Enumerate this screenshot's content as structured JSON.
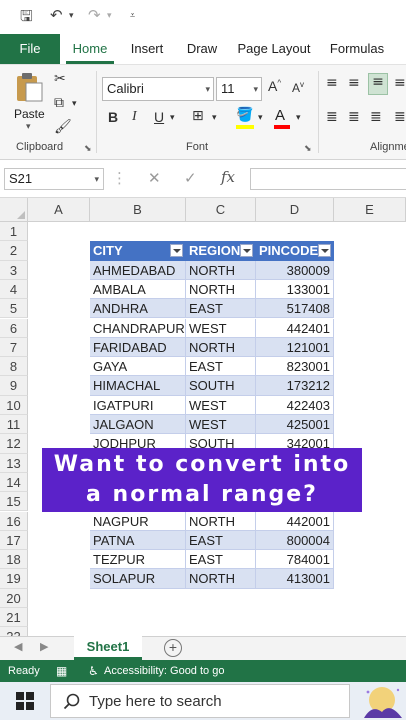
{
  "quick_access": {
    "save_icon": "save-icon",
    "undo_icon": "undo-icon",
    "redo_icon": "redo-icon",
    "customize_icon": "customize-icon"
  },
  "ribbon_tabs": [
    {
      "label": "File"
    },
    {
      "label": "Home"
    },
    {
      "label": "Insert"
    },
    {
      "label": "Draw"
    },
    {
      "label": "Page Layout"
    },
    {
      "label": "Formulas"
    }
  ],
  "ribbon": {
    "paste_label": "Paste",
    "clipboard_label": "Clipboard",
    "font_label": "Font",
    "font_name": "Calibri",
    "font_size": "11",
    "alignment_label": "Alignme",
    "bold": "B",
    "italic": "I",
    "underline": "U",
    "font_color_letter": "A",
    "grow_font_letter": "A",
    "shrink_font_letter": "A",
    "accent_color": "#217346",
    "highlight_color": "#ffff00",
    "font_color": "#ff0000"
  },
  "formula_bar": {
    "name_box": "S21",
    "fx": "fx",
    "value": ""
  },
  "columns": [
    "A",
    "B",
    "C",
    "D",
    "E"
  ],
  "rows": [
    "1",
    "2",
    "3",
    "4",
    "5",
    "6",
    "7",
    "8",
    "9",
    "10",
    "11",
    "12",
    "13",
    "14",
    "15",
    "16",
    "17",
    "18",
    "19",
    "20",
    "21",
    "22"
  ],
  "table": {
    "header_color": "#4472c4",
    "band_color": "#d9e1f2",
    "headers": [
      "CITY",
      "REGION",
      "PINCODE"
    ],
    "rows": [
      [
        "AHMEDABAD",
        "NORTH",
        "380009"
      ],
      [
        "AMBALA",
        "NORTH",
        "133001"
      ],
      [
        "ANDHRA",
        "EAST",
        "517408"
      ],
      [
        "CHANDRAPUR",
        "WEST",
        "442401"
      ],
      [
        "FARIDABAD",
        "NORTH",
        "121001"
      ],
      [
        "GAYA",
        "EAST",
        "823001"
      ],
      [
        "HIMACHAL",
        "SOUTH",
        "173212"
      ],
      [
        "IGATPURI",
        "WEST",
        "422403"
      ],
      [
        "JALGAON",
        "WEST",
        "425001"
      ],
      [
        "JODHPUR",
        "SOUTH",
        "342001"
      ],
      [
        "",
        "",
        ""
      ],
      [
        "",
        "",
        ""
      ],
      [
        "",
        "",
        ""
      ],
      [
        "NAGPUR",
        "NORTH",
        "442001"
      ],
      [
        "PATNA",
        "EAST",
        "800004"
      ],
      [
        "TEZPUR",
        "EAST",
        "784001"
      ],
      [
        "SOLAPUR",
        "NORTH",
        "413001"
      ]
    ]
  },
  "caption": {
    "line1": "Want to convert into",
    "line2": "a normal range?",
    "color": "#5b22c9"
  },
  "sheets": {
    "active": "Sheet1"
  },
  "status_bar": {
    "ready": "Ready",
    "accessibility": "Accessibility: Good to go"
  },
  "taskbar": {
    "search_placeholder": "Type here to search"
  }
}
